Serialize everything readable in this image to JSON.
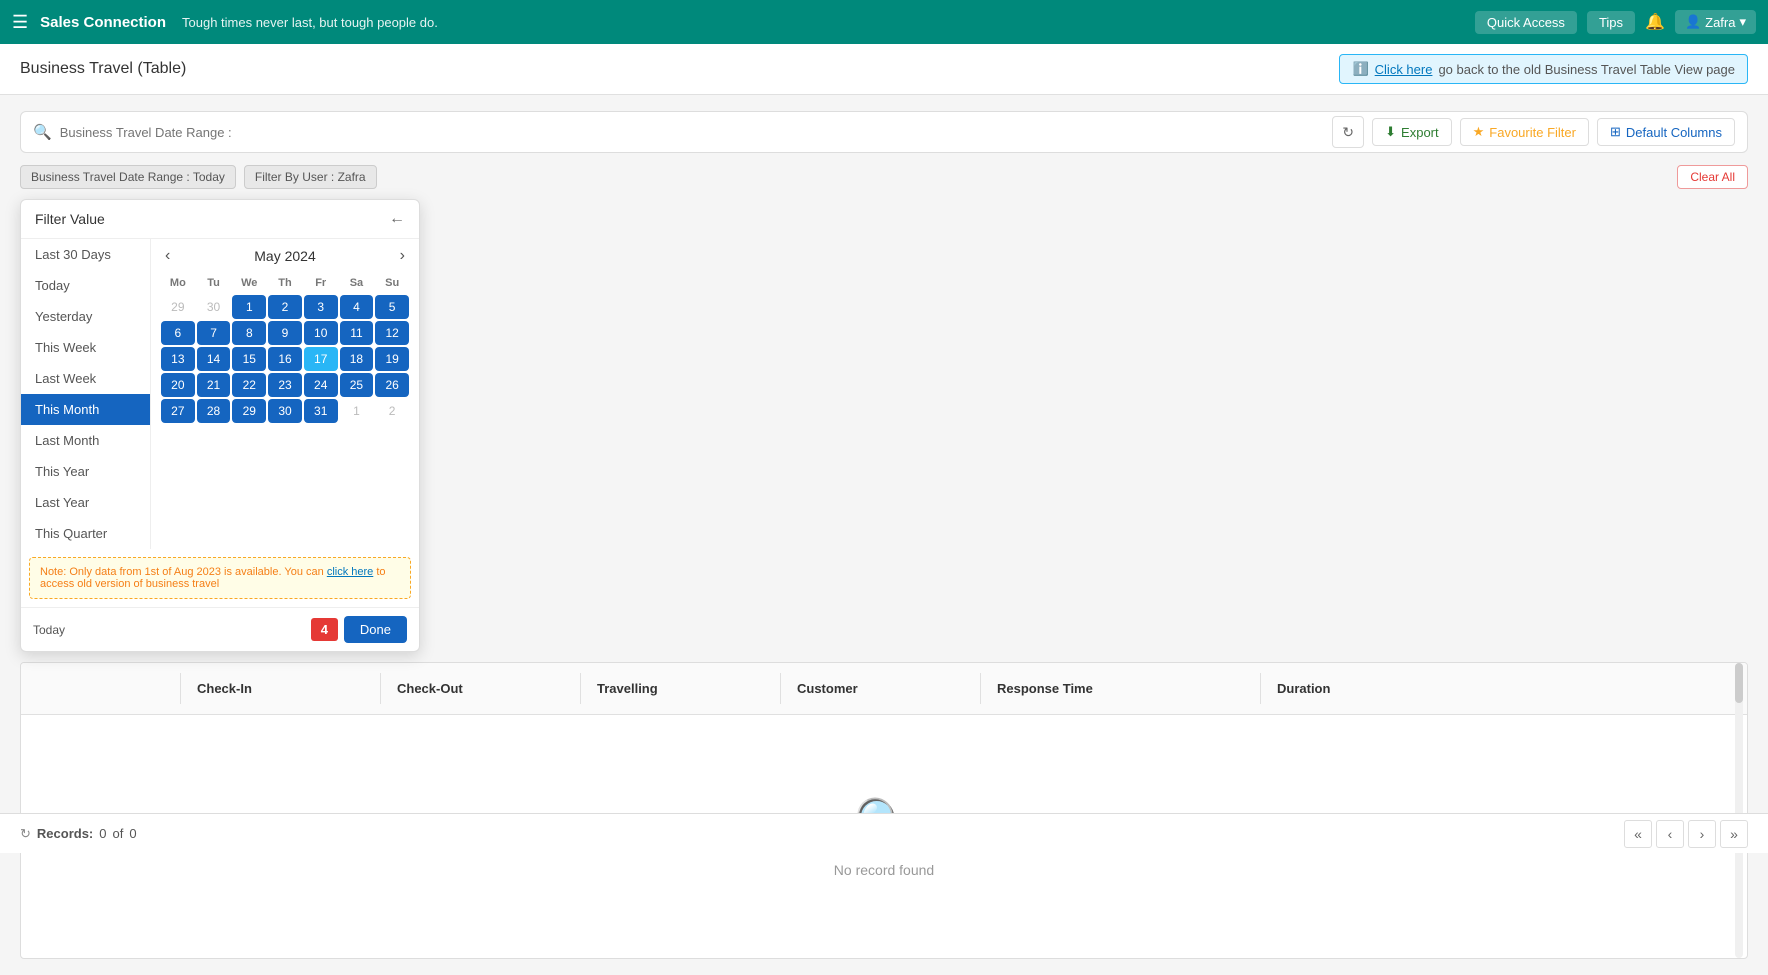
{
  "app": {
    "brand": "Sales Connection",
    "tagline": "Tough times never last, but tough people do.",
    "quick_access": "Quick Access",
    "tips": "Tips",
    "user": "Zafra"
  },
  "page": {
    "title": "Business Travel (Table)",
    "info_text": "go back to the old Business Travel Table View page",
    "info_link": "Click here"
  },
  "toolbar": {
    "search_placeholder": "Business Travel Date Range :",
    "export": "Export",
    "favourite": "Favourite Filter",
    "columns": "Default Columns"
  },
  "filters": {
    "date_range_tag": "Business Travel Date Range : Today",
    "user_tag": "Filter By User : Zafra",
    "clear_all": "Clear All"
  },
  "filter_dropdown": {
    "title": "Filter Value",
    "list_items": [
      "Last 30 Days",
      "Today",
      "Yesterday",
      "This Week",
      "Last Week",
      "This Month",
      "Last Month",
      "This Year",
      "Last Year",
      "This Quarter"
    ],
    "active_item": "This Month",
    "calendar": {
      "month": "May",
      "year": "2024",
      "day_headers": [
        "Mo",
        "Tu",
        "We",
        "Th",
        "Fr",
        "Sa",
        "Su"
      ],
      "weeks": [
        [
          {
            "day": "29",
            "type": "other"
          },
          {
            "day": "30",
            "type": "other"
          },
          {
            "day": "1",
            "type": "highlight"
          },
          {
            "day": "2",
            "type": "highlight"
          },
          {
            "day": "3",
            "type": "highlight"
          },
          {
            "day": "4",
            "type": "highlight"
          },
          {
            "day": "5",
            "type": "highlight"
          }
        ],
        [
          {
            "day": "6",
            "type": "highlight"
          },
          {
            "day": "7",
            "type": "highlight"
          },
          {
            "day": "8",
            "type": "highlight"
          },
          {
            "day": "9",
            "type": "highlight"
          },
          {
            "day": "10",
            "type": "highlight"
          },
          {
            "day": "11",
            "type": "highlight"
          },
          {
            "day": "12",
            "type": "highlight"
          }
        ],
        [
          {
            "day": "13",
            "type": "highlight"
          },
          {
            "day": "14",
            "type": "highlight"
          },
          {
            "day": "15",
            "type": "highlight"
          },
          {
            "day": "16",
            "type": "highlight"
          },
          {
            "day": "17",
            "type": "today"
          },
          {
            "day": "18",
            "type": "highlight"
          },
          {
            "day": "19",
            "type": "highlight"
          }
        ],
        [
          {
            "day": "20",
            "type": "highlight"
          },
          {
            "day": "21",
            "type": "highlight"
          },
          {
            "day": "22",
            "type": "highlight"
          },
          {
            "day": "23",
            "type": "highlight"
          },
          {
            "day": "24",
            "type": "highlight"
          },
          {
            "day": "25",
            "type": "highlight"
          },
          {
            "day": "26",
            "type": "highlight"
          }
        ],
        [
          {
            "day": "27",
            "type": "highlight"
          },
          {
            "day": "28",
            "type": "highlight"
          },
          {
            "day": "29",
            "type": "highlight"
          },
          {
            "day": "30",
            "type": "highlight"
          },
          {
            "day": "31",
            "type": "highlight"
          },
          {
            "day": "1",
            "type": "other"
          },
          {
            "day": "2",
            "type": "other"
          }
        ]
      ]
    },
    "note": "Note: Only data from 1st of Aug 2023 is available. You can",
    "note_link": "click here",
    "note_suffix": "to access old version of business travel",
    "today_label": "Today",
    "day_badge": "4",
    "done_label": "Done"
  },
  "table": {
    "columns": [
      "",
      "Check-In",
      "Check-Out",
      "Travelling",
      "Customer",
      "Response Time",
      "Duration"
    ],
    "no_record": "No record found"
  },
  "footer": {
    "records_label": "Records:",
    "records_count": "0",
    "records_of": "of",
    "records_total": "0"
  }
}
